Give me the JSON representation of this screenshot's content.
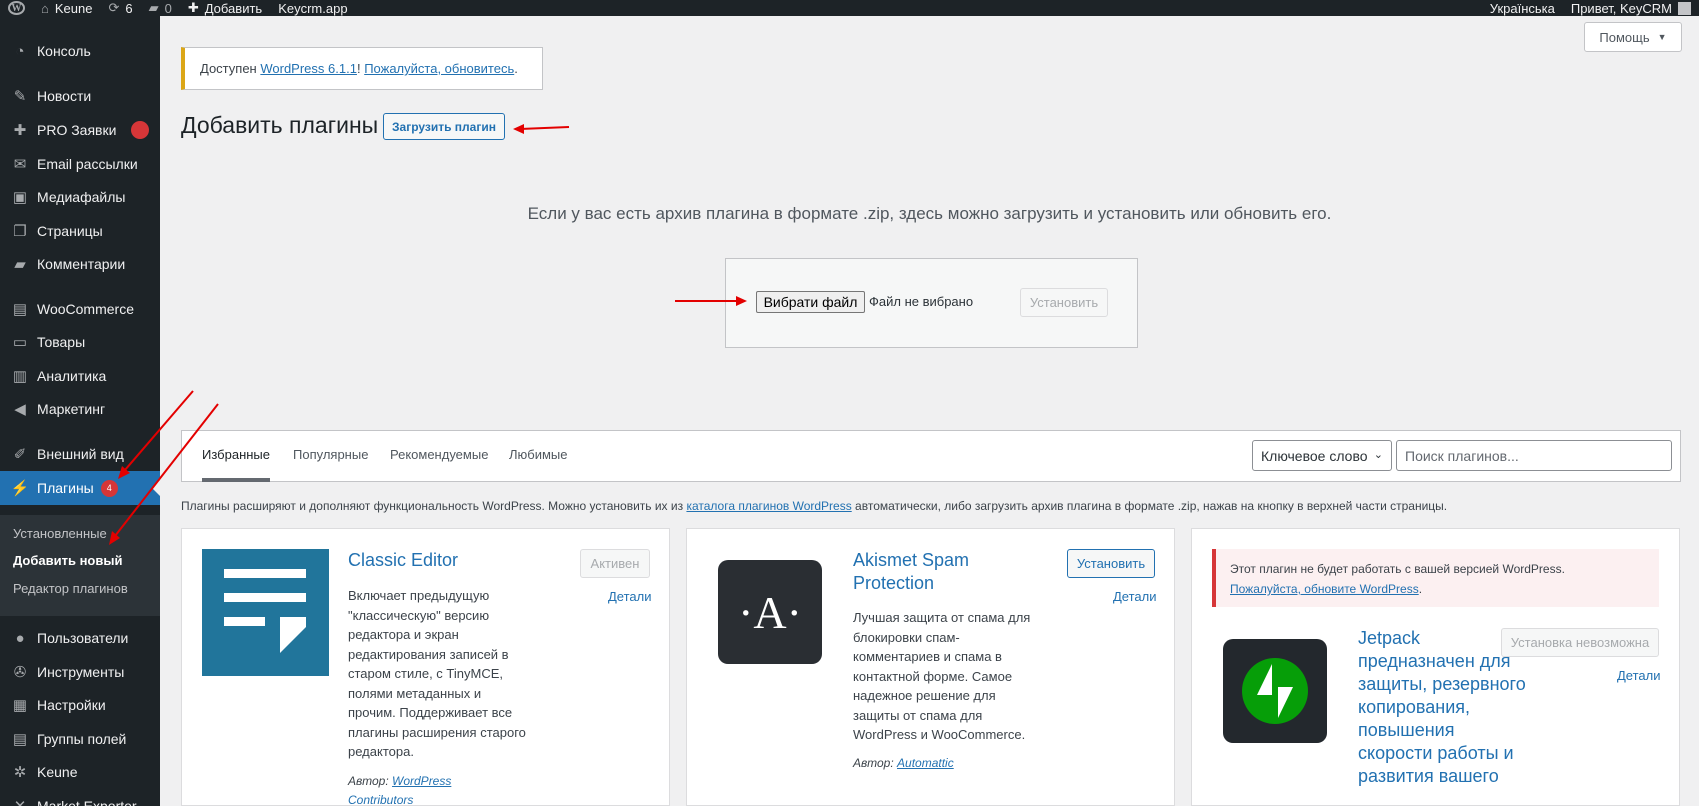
{
  "adminbar": {
    "site_name": "Keune",
    "updates_count": "6",
    "comments_count": "0",
    "new_label": "Добавить",
    "keycrm_link": "Keycrm.app",
    "language": "Українська",
    "greeting": "Привет, KeyCRM"
  },
  "sidebar": {
    "items": [
      {
        "label": "Консоль",
        "icon": "dashboard-icon"
      },
      {
        "label": "Новости",
        "icon": "pin-icon"
      },
      {
        "label": "PRO Заявки",
        "icon": "plus-icon"
      },
      {
        "label": "Email рассылки",
        "icon": "email-icon"
      },
      {
        "label": "Медиафайлы",
        "icon": "media-icon"
      },
      {
        "label": "Страницы",
        "icon": "pages-icon"
      },
      {
        "label": "Комментарии",
        "icon": "comments-icon"
      },
      {
        "label": "WooCommerce",
        "icon": "woocommerce-icon"
      },
      {
        "label": "Товары",
        "icon": "products-icon"
      },
      {
        "label": "Аналитика",
        "icon": "analytics-icon"
      },
      {
        "label": "Маркетинг",
        "icon": "megaphone-icon"
      },
      {
        "label": "Внешний вид",
        "icon": "brush-icon"
      },
      {
        "label": "Плагины",
        "icon": "plugins-icon",
        "badge": "4"
      },
      {
        "label": "Пользователи",
        "icon": "users-icon"
      },
      {
        "label": "Инструменты",
        "icon": "tools-icon"
      },
      {
        "label": "Настройки",
        "icon": "settings-icon"
      },
      {
        "label": "Группы полей",
        "icon": "field-groups-icon"
      },
      {
        "label": "Keune",
        "icon": "gear-icon"
      },
      {
        "label": "Market Exporter",
        "icon": "exporter-icon"
      }
    ],
    "submenu": [
      "Установленные",
      "Добавить новый",
      "Редактор плагинов"
    ]
  },
  "notice": {
    "prefix": "Доступен ",
    "version_link": "WordPress 6.1.1",
    "middle": "! ",
    "update_link": "Пожалуйста, обновитесь",
    "suffix": "."
  },
  "help_label": "Помощь",
  "page": {
    "title": "Добавить плагины",
    "upload_button": "Загрузить плагин",
    "upload_hint": "Если у вас есть архив плагина в формате .zip, здесь можно загрузить и установить или обновить его.",
    "choose_file": "Вибрати файл",
    "no_file": "Файл не вибрано",
    "install_now": "Установить"
  },
  "filters": {
    "tabs": [
      "Избранные",
      "Популярные",
      "Рекомендуемые",
      "Любимые"
    ],
    "search_type": "Ключевое слово",
    "search_placeholder": "Поиск плагинов..."
  },
  "intro": {
    "before": "Плагины расширяют и дополняют функциональность WordPress. Можно установить их из ",
    "link": "каталога плагинов WordPress",
    "after": " автоматически, либо загрузить архив плагина в формате .zip, нажав на кнопку в верхней части страницы."
  },
  "cards": [
    {
      "title": "Classic Editor",
      "action": "Активен",
      "details": "Детали",
      "desc": "Включает предыдущую \"классическую\" версию редактора и экран редактирования записей в старом стиле, с TinyMCE, полями метаданных и прочим. Поддерживает все плагины расширения старого редактора.",
      "author_label": "Автор: ",
      "author": "WordPress Contributors",
      "icon_color": "#21759b"
    },
    {
      "title": "Akismet Spam Protection",
      "action": "Установить",
      "details": "Детали",
      "desc": "Лучшая защита от спама для блокировки спам-комментариев и спама в контактной форме. Самое надежное решение для защиты от спама для WordPress и WooCommerce.",
      "author_label": "Автор: ",
      "author": "Automattic",
      "icon_color": "#2a2e33",
      "icon_letter": "·A·"
    },
    {
      "incompat_text": "Этот плагин не будет работать с вашей версией WordPress.",
      "incompat_link": "Пожалуйста, обновите WordPress",
      "incompat_suffix": ".",
      "title": "Jetpack предназначен для защиты, резервного копирования, повышения скорости работы и развития вашего",
      "action": "Установка невозможна",
      "details": "Детали",
      "icon_color": "#23282d",
      "accent_color": "#069e08"
    }
  ],
  "colors": {
    "admin_bg": "#1d2327",
    "accent": "#2271b1",
    "badge": "#d63638",
    "notice_warning": "#dba617",
    "annotation_arrow": "#e30000"
  }
}
